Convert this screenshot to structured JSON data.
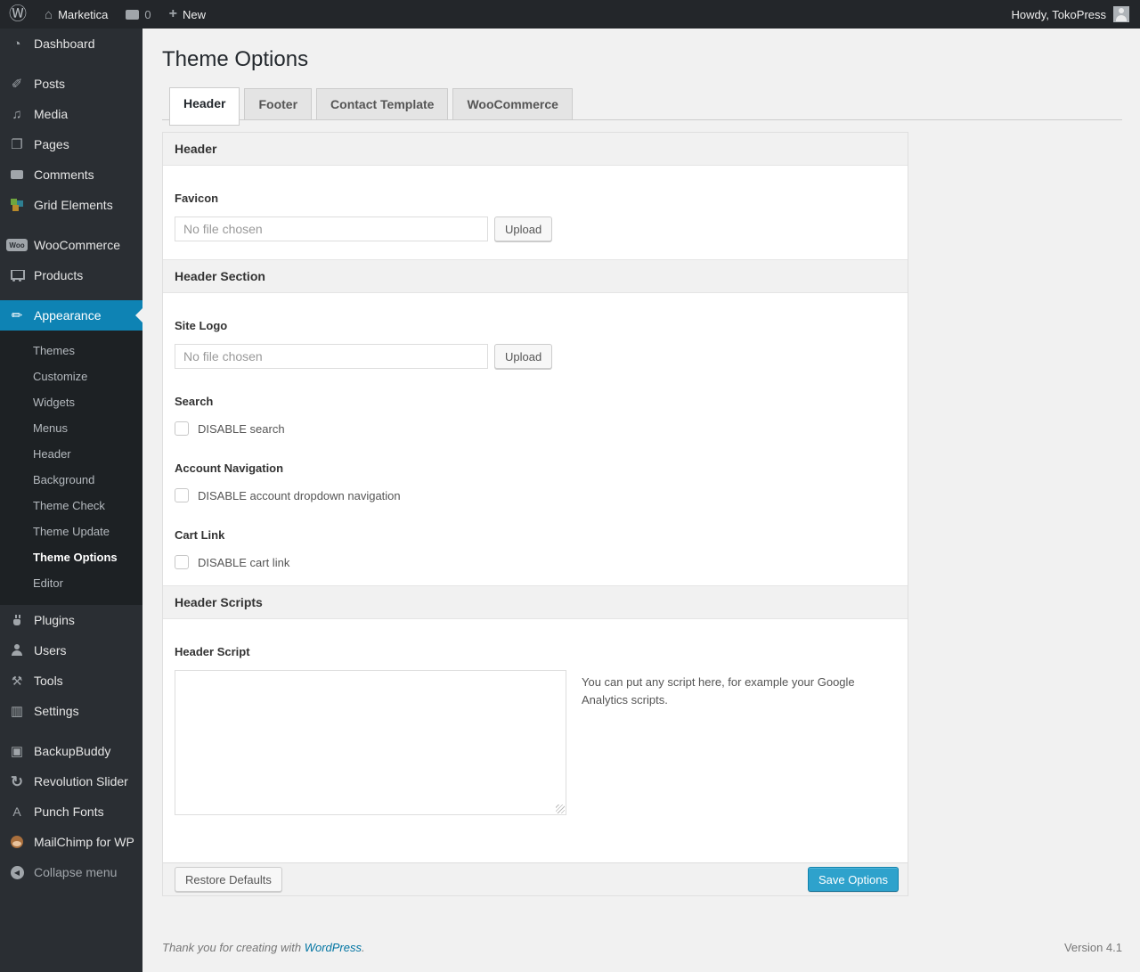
{
  "colors": {
    "accent_active_menu": "#0e83b4",
    "primary_button": "#2ea2cc",
    "link": "#0074a2",
    "sidebar_bg": "#2a2e33",
    "submenu_bg": "#1d2124",
    "page_bg": "#f1f1f1"
  },
  "admin_bar": {
    "wp_logo_icon": "wordpress-logo-icon",
    "site_name": "Marketica",
    "comments_count": "0",
    "new_label": "New",
    "howdy": "Howdy, TokoPress"
  },
  "sidebar": {
    "items": [
      {
        "label": "Dashboard",
        "icon": "dashboard-icon"
      },
      {
        "label": "Posts",
        "icon": "pin-icon"
      },
      {
        "label": "Media",
        "icon": "media-icon"
      },
      {
        "label": "Pages",
        "icon": "pages-icon"
      },
      {
        "label": "Comments",
        "icon": "comment-bubble-icon"
      },
      {
        "label": "Grid Elements",
        "icon": "grid-elements-icon"
      },
      {
        "label": "WooCommerce",
        "icon": "woocommerce-badge-icon"
      },
      {
        "label": "Products",
        "icon": "cart-icon"
      },
      {
        "label": "Appearance",
        "icon": "brush-icon",
        "active": true
      },
      {
        "label": "Plugins",
        "icon": "plug-icon"
      },
      {
        "label": "Users",
        "icon": "user-icon"
      },
      {
        "label": "Tools",
        "icon": "wrench-icon"
      },
      {
        "label": "Settings",
        "icon": "sliders-icon"
      },
      {
        "label": "BackupBuddy",
        "icon": "backup-disk-icon"
      },
      {
        "label": "Revolution Slider",
        "icon": "refresh-icon"
      },
      {
        "label": "Punch Fonts",
        "icon": "letter-a-icon"
      },
      {
        "label": "MailChimp for WP",
        "icon": "mailchimp-monkey-icon"
      }
    ],
    "appearance_submenu": [
      {
        "label": "Themes"
      },
      {
        "label": "Customize"
      },
      {
        "label": "Widgets"
      },
      {
        "label": "Menus"
      },
      {
        "label": "Header"
      },
      {
        "label": "Background"
      },
      {
        "label": "Theme Check"
      },
      {
        "label": "Theme Update"
      },
      {
        "label": "Theme Options",
        "current": true
      },
      {
        "label": "Editor"
      }
    ],
    "collapse_label": "Collapse menu"
  },
  "page": {
    "title": "Theme Options",
    "tabs": [
      {
        "label": "Header",
        "active": true
      },
      {
        "label": "Footer"
      },
      {
        "label": "Contact Template"
      },
      {
        "label": "WooCommerce"
      }
    ]
  },
  "panel": {
    "band_header": "Header",
    "favicon_label": "Favicon",
    "file_value": "No file chosen",
    "upload_label": "Upload",
    "band_header_section": "Header Section",
    "site_logo_label": "Site Logo",
    "search_label": "Search",
    "disable_search_label": "DISABLE search",
    "account_nav_label": "Account Navigation",
    "disable_account_label": "DISABLE account dropdown navigation",
    "cart_link_label": "Cart Link",
    "disable_cart_label": "DISABLE cart link",
    "band_header_scripts": "Header Scripts",
    "header_script_label": "Header Script",
    "script_hint": "You can put any script here, for example your Google Analytics scripts.",
    "restore_label": "Restore Defaults",
    "save_label": "Save Options"
  },
  "footer": {
    "thanks_prefix": "Thank you for creating with ",
    "link_text": "WordPress",
    "thanks_suffix": ".",
    "version": "Version 4.1"
  }
}
